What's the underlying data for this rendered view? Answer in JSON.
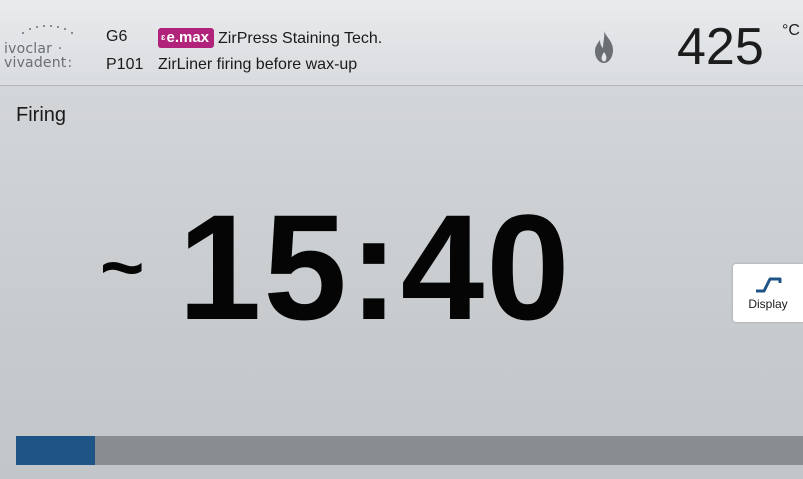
{
  "header": {
    "logo": {
      "line1": "ivoclar",
      "line2": "vivadent"
    },
    "group": {
      "code": "G6",
      "brand_badge": "e.max",
      "brand_badge_prefix": "ɛ",
      "name": "ZirPress Staining Tech."
    },
    "program": {
      "code": "P101",
      "name": "ZirLiner firing before wax-up"
    },
    "flame_icon": "flame-icon",
    "temperature": {
      "value": "425",
      "unit": "°C"
    }
  },
  "main": {
    "status": "Firing",
    "time_prefix": "~",
    "time": "15:40",
    "display_button": {
      "icon": "firing-curve-icon",
      "label": "Display"
    },
    "progress": {
      "fraction": 0.1
    }
  },
  "colors": {
    "emax_badge": "#b1237a",
    "progress_fill": "#1f5486",
    "progress_track": "#888d92",
    "flame": "#6b6f73",
    "curve_icon": "#1f5486"
  }
}
